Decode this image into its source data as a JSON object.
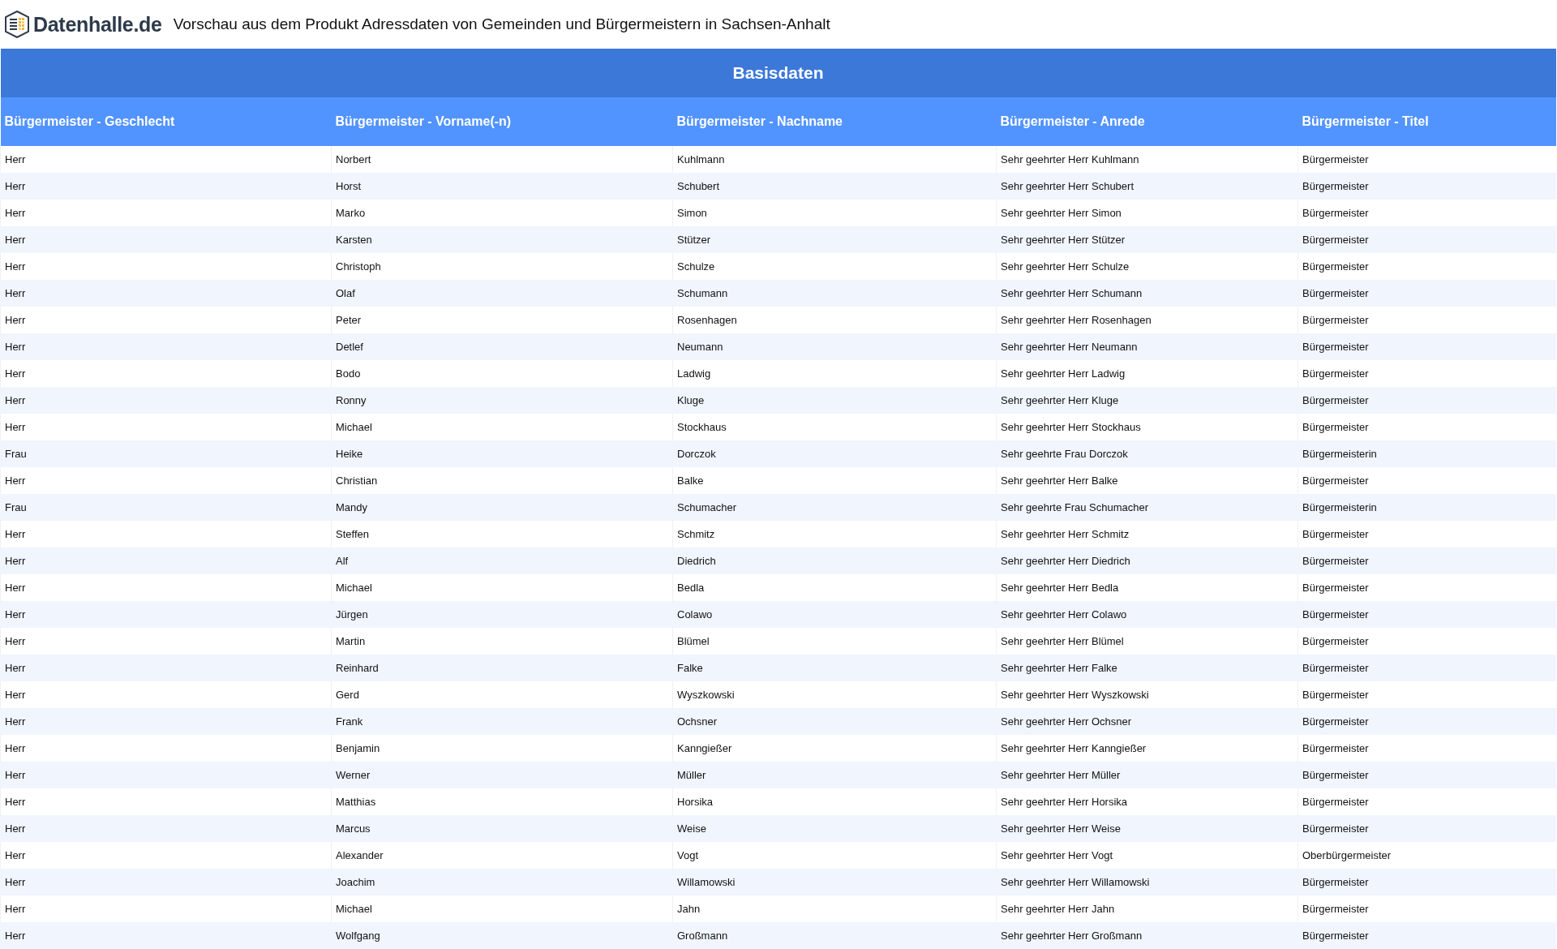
{
  "header": {
    "logo_text": "Datenhalle.de",
    "title": "Vorschau aus dem Produkt Adressdaten von Gemeinden und Bürgermeistern in Sachsen-Anhalt"
  },
  "table": {
    "group_title": "Basisdaten",
    "columns": [
      "Bürgermeister - Geschlecht",
      "Bürgermeister - Vorname(-n)",
      "Bürgermeister - Nachname",
      "Bürgermeister - Anrede",
      "Bürgermeister - Titel"
    ],
    "rows": [
      [
        "Herr",
        "Norbert",
        "Kuhlmann",
        "Sehr geehrter Herr Kuhlmann",
        "Bürgermeister"
      ],
      [
        "Herr",
        "Horst",
        "Schubert",
        "Sehr geehrter Herr Schubert",
        "Bürgermeister"
      ],
      [
        "Herr",
        "Marko",
        "Simon",
        "Sehr geehrter Herr Simon",
        "Bürgermeister"
      ],
      [
        "Herr",
        "Karsten",
        "Stützer",
        "Sehr geehrter Herr Stützer",
        "Bürgermeister"
      ],
      [
        "Herr",
        "Christoph",
        "Schulze",
        "Sehr geehrter Herr Schulze",
        "Bürgermeister"
      ],
      [
        "Herr",
        "Olaf",
        "Schumann",
        "Sehr geehrter Herr Schumann",
        "Bürgermeister"
      ],
      [
        "Herr",
        "Peter",
        "Rosenhagen",
        "Sehr geehrter Herr Rosenhagen",
        "Bürgermeister"
      ],
      [
        "Herr",
        "Detlef",
        "Neumann",
        "Sehr geehrter Herr Neumann",
        "Bürgermeister"
      ],
      [
        "Herr",
        "Bodo",
        "Ladwig",
        "Sehr geehrter Herr Ladwig",
        "Bürgermeister"
      ],
      [
        "Herr",
        "Ronny",
        "Kluge",
        "Sehr geehrter Herr Kluge",
        "Bürgermeister"
      ],
      [
        "Herr",
        "Michael",
        "Stockhaus",
        "Sehr geehrter Herr Stockhaus",
        "Bürgermeister"
      ],
      [
        "Frau",
        "Heike",
        "Dorczok",
        "Sehr geehrte Frau Dorczok",
        "Bürgermeisterin"
      ],
      [
        "Herr",
        "Christian",
        "Balke",
        "Sehr geehrter Herr Balke",
        "Bürgermeister"
      ],
      [
        "Frau",
        "Mandy",
        "Schumacher",
        "Sehr geehrte Frau Schumacher",
        "Bürgermeisterin"
      ],
      [
        "Herr",
        "Steffen",
        "Schmitz",
        "Sehr geehrter Herr Schmitz",
        "Bürgermeister"
      ],
      [
        "Herr",
        "Alf",
        "Diedrich",
        "Sehr geehrter Herr Diedrich",
        "Bürgermeister"
      ],
      [
        "Herr",
        "Michael",
        "Bedla",
        "Sehr geehrter Herr Bedla",
        "Bürgermeister"
      ],
      [
        "Herr",
        "Jürgen",
        "Colawo",
        "Sehr geehrter Herr Colawo",
        "Bürgermeister"
      ],
      [
        "Herr",
        "Martin",
        "Blümel",
        "Sehr geehrter Herr Blümel",
        "Bürgermeister"
      ],
      [
        "Herr",
        "Reinhard",
        "Falke",
        "Sehr geehrter Herr Falke",
        "Bürgermeister"
      ],
      [
        "Herr",
        "Gerd",
        "Wyszkowski",
        "Sehr geehrter Herr Wyszkowski",
        "Bürgermeister"
      ],
      [
        "Herr",
        "Frank",
        "Ochsner",
        "Sehr geehrter Herr Ochsner",
        "Bürgermeister"
      ],
      [
        "Herr",
        "Benjamin",
        "Kanngießer",
        "Sehr geehrter Herr Kanngießer",
        "Bürgermeister"
      ],
      [
        "Herr",
        "Werner",
        "Müller",
        "Sehr geehrter Herr Müller",
        "Bürgermeister"
      ],
      [
        "Herr",
        "Matthias",
        "Horsika",
        "Sehr geehrter Herr Horsika",
        "Bürgermeister"
      ],
      [
        "Herr",
        "Marcus",
        "Weise",
        "Sehr geehrter Herr Weise",
        "Bürgermeister"
      ],
      [
        "Herr",
        "Alexander",
        "Vogt",
        "Sehr geehrter Herr Vogt",
        "Oberbürgermeister"
      ],
      [
        "Herr",
        "Joachim",
        "Willamowski",
        "Sehr geehrter Herr Willamowski",
        "Bürgermeister"
      ],
      [
        "Herr",
        "Michael",
        "Jahn",
        "Sehr geehrter Herr Jahn",
        "Bürgermeister"
      ],
      [
        "Herr",
        "Wolfgang",
        "Großmann",
        "Sehr geehrter Herr Großmann",
        "Bürgermeister"
      ]
    ]
  }
}
